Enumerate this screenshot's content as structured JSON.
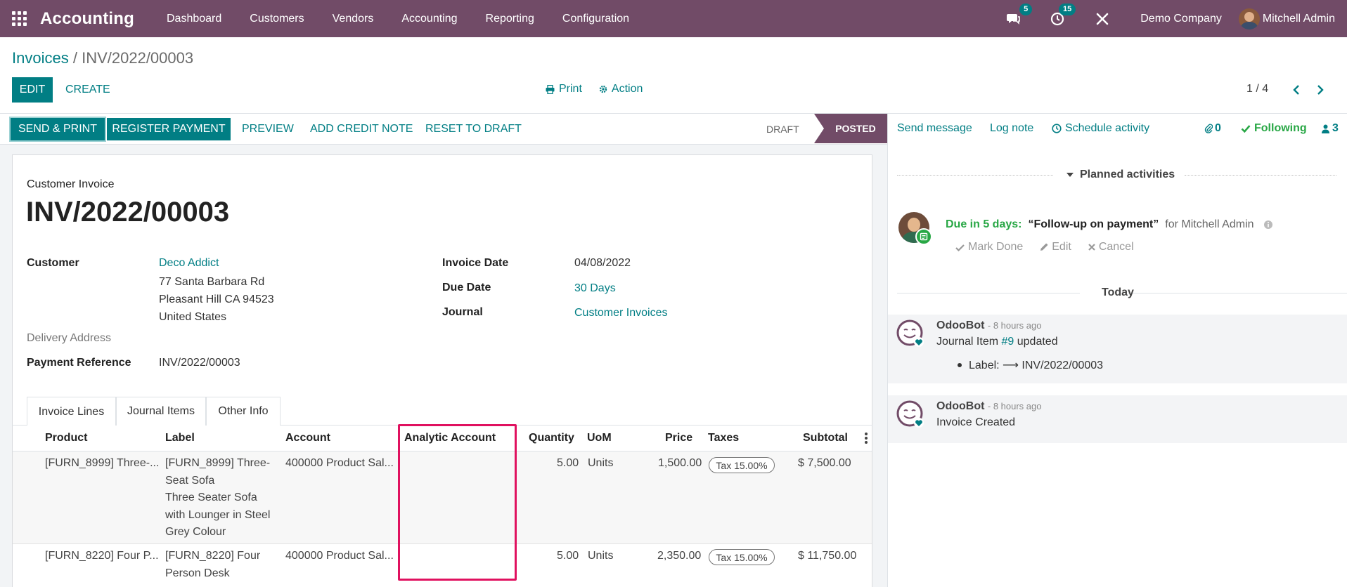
{
  "navbar": {
    "app_name": "Accounting",
    "menu": [
      "Dashboard",
      "Customers",
      "Vendors",
      "Accounting",
      "Reporting",
      "Configuration"
    ],
    "messages_badge": "5",
    "activities_badge": "15",
    "company": "Demo Company",
    "user": "Mitchell Admin",
    "bg_color": "#714B67"
  },
  "breadcrumb": {
    "parent": "Invoices",
    "separator": "/",
    "current": "INV/2022/00003"
  },
  "control_panel": {
    "edit_label": "EDIT",
    "create_label": "CREATE",
    "print_label": "Print",
    "action_label": "Action",
    "pager": "1 / 4"
  },
  "statusbar": {
    "send_print": "SEND & PRINT",
    "register_payment": "REGISTER PAYMENT",
    "preview": "PREVIEW",
    "add_credit_note": "ADD CREDIT NOTE",
    "reset_to_draft": "RESET TO DRAFT",
    "stage_draft": "DRAFT",
    "stage_posted": "POSTED"
  },
  "invoice": {
    "doc_type": "Customer Invoice",
    "number": "INV/2022/00003",
    "customer_label": "Customer",
    "customer_name": "Deco Addict",
    "address_line1": "77 Santa Barbara Rd",
    "address_line2": "Pleasant Hill CA 94523",
    "address_line3": "United States",
    "delivery_label": "Delivery Address",
    "payment_ref_label": "Payment Reference",
    "payment_ref": "INV/2022/00003",
    "invoice_date_label": "Invoice Date",
    "invoice_date": "04/08/2022",
    "due_date_label": "Due Date",
    "due_date": "30 Days",
    "journal_label": "Journal",
    "journal": "Customer Invoices"
  },
  "tabs": [
    "Invoice Lines",
    "Journal Items",
    "Other Info"
  ],
  "table": {
    "headers": [
      "Product",
      "Label",
      "Account",
      "Analytic Account",
      "Quantity",
      "UoM",
      "Price",
      "Taxes",
      "Subtotal"
    ],
    "rows": [
      {
        "product": "[FURN_8999] Three-...",
        "label_lines": [
          "[FURN_8999] Three-",
          "Seat Sofa",
          "Three Seater Sofa",
          "with Lounger in Steel",
          "Grey Colour"
        ],
        "account": "400000 Product Sal...",
        "analytic": "",
        "quantity": "5.00",
        "uom": "Units",
        "price": "1,500.00",
        "tax": "Tax 15.00%",
        "subtotal": "$ 7,500.00"
      },
      {
        "product": "[FURN_8220] Four P...",
        "label_lines": [
          "[FURN_8220] Four",
          "Person Desk"
        ],
        "account": "400000 Product Sal...",
        "analytic": "",
        "quantity": "5.00",
        "uom": "Units",
        "price": "2,350.00",
        "tax": "Tax 15.00%",
        "subtotal": "$ 11,750.00"
      }
    ]
  },
  "chatter": {
    "send_message": "Send message",
    "log_note": "Log note",
    "schedule_activity": "Schedule activity",
    "attachments_count": "0",
    "following": "Following",
    "followers_count": "3",
    "planned_title": "Planned activities",
    "activity": {
      "due": "Due in 5 days:",
      "summary": "“Follow-up on payment”",
      "for_user": "for Mitchell Admin",
      "mark_done": "Mark Done",
      "edit": "Edit",
      "cancel": "Cancel"
    },
    "today_label": "Today",
    "messages": [
      {
        "author": "OdooBot",
        "time": "- 8 hours ago",
        "text_prefix": "Journal Item",
        "link": "#9",
        "text_suffix": "updated",
        "change": "Label: ⟶ INV/2022/00003"
      },
      {
        "author": "OdooBot",
        "time": "- 8 hours ago",
        "text": "Invoice Created"
      }
    ]
  },
  "colors": {
    "primary": "#017e84",
    "brand": "#714B67",
    "highlight": "#e0115f",
    "success": "#28a745"
  }
}
